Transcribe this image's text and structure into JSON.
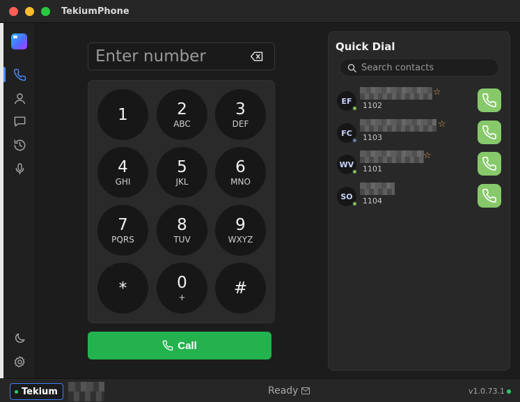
{
  "window": {
    "title": "TekiumPhone"
  },
  "sidebar": {
    "items": [
      {
        "name": "phone",
        "icon": "phone-icon",
        "active": true
      },
      {
        "name": "contacts",
        "icon": "user-icon",
        "active": false
      },
      {
        "name": "messages",
        "icon": "chat-icon",
        "active": false
      },
      {
        "name": "history",
        "icon": "history-icon",
        "active": false
      },
      {
        "name": "voicemail",
        "icon": "microphone-icon",
        "active": false
      }
    ],
    "bottom": [
      {
        "name": "theme",
        "icon": "moon-icon"
      },
      {
        "name": "settings",
        "icon": "gear-icon"
      }
    ]
  },
  "dialer": {
    "number_placeholder": "Enter number",
    "number_value": "",
    "keys": [
      {
        "digit": "1",
        "letters": ""
      },
      {
        "digit": "2",
        "letters": "ABC"
      },
      {
        "digit": "3",
        "letters": "DEF"
      },
      {
        "digit": "4",
        "letters": "GHI"
      },
      {
        "digit": "5",
        "letters": "JKL"
      },
      {
        "digit": "6",
        "letters": "MNO"
      },
      {
        "digit": "7",
        "letters": "PQRS"
      },
      {
        "digit": "8",
        "letters": "TUV"
      },
      {
        "digit": "9",
        "letters": "WXYZ"
      },
      {
        "digit": "*",
        "letters": ""
      },
      {
        "digit": "0",
        "letters": "+"
      },
      {
        "digit": "#",
        "letters": ""
      }
    ],
    "call_label": "Call"
  },
  "quick_dial": {
    "title": "Quick Dial",
    "search_placeholder": "Search contacts",
    "contacts": [
      {
        "initials": "EF",
        "ext": "1102",
        "favorite": "☆",
        "presence_color": "#7dbb5a"
      },
      {
        "initials": "FC",
        "ext": "1103",
        "favorite": "☆",
        "presence_color": "#6b7ea6"
      },
      {
        "initials": "WV",
        "ext": "1101",
        "favorite": "☆",
        "presence_color": "#7dbb5a"
      },
      {
        "initials": "SO",
        "ext": "1104",
        "favorite": "",
        "presence_color": "#7dbb5a"
      }
    ]
  },
  "statusbar": {
    "brand": "Tekium",
    "status": "Ready",
    "version": "v1.0.73.1"
  },
  "colors": {
    "accent_blue": "#4a8cff",
    "call_green": "#23b24e",
    "dial_button_green": "#86c86a",
    "online": "#2ecc71"
  }
}
